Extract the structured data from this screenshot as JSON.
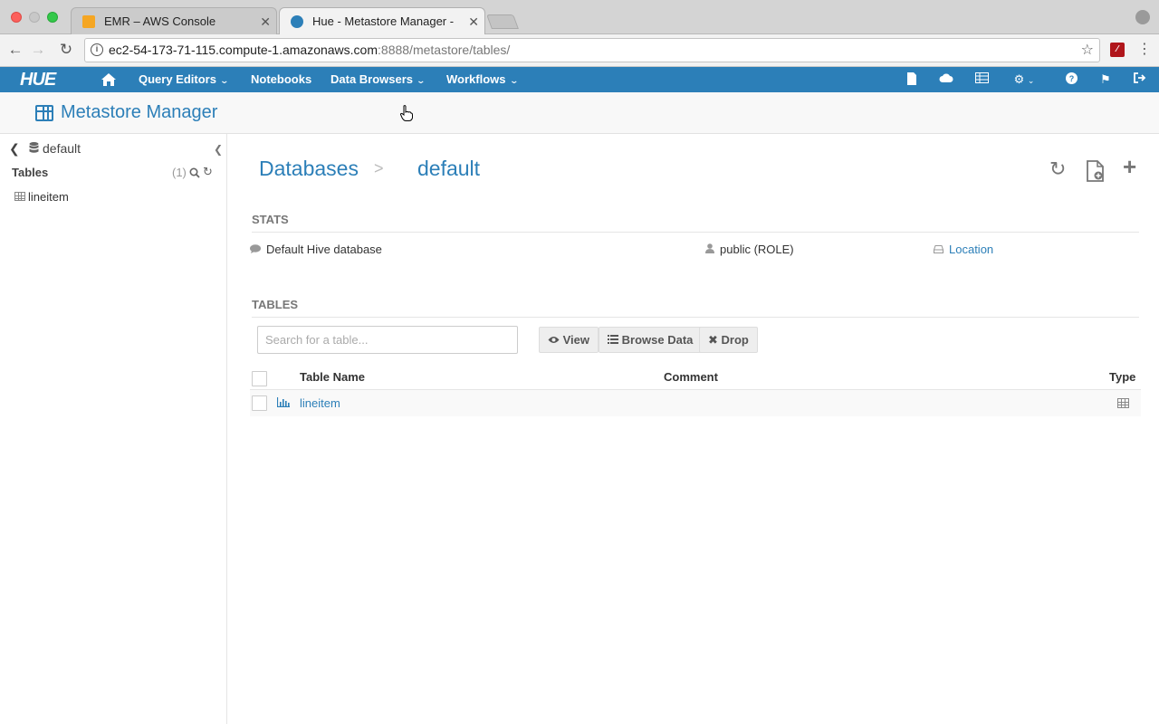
{
  "browser": {
    "tabs": [
      {
        "title": "EMR – AWS Console",
        "active": false
      },
      {
        "title": "Hue - Metastore Manager - Me",
        "active": true
      }
    ],
    "url": {
      "host": "ec2-54-173-71-115.compute-1.amazonaws.com",
      "rest": ":8888/metastore/tables/"
    },
    "close_glyph": "✕"
  },
  "hue_nav": {
    "logo": "HUE",
    "items": [
      {
        "label": "Query Editors",
        "has_dropdown": true
      },
      {
        "label": "Notebooks",
        "has_dropdown": false
      },
      {
        "label": "Data Browsers",
        "has_dropdown": true
      },
      {
        "label": "Workflows",
        "has_dropdown": true
      }
    ],
    "right_icons": [
      "file-icon",
      "cloud-icon",
      "table-icon",
      "cogs-icon",
      "help-icon",
      "flag-icon",
      "logout-icon"
    ]
  },
  "page_header": {
    "title": "Metastore Manager"
  },
  "sidebar": {
    "database": "default",
    "tables_label": "Tables",
    "tables_count": "(1)",
    "tables": [
      {
        "name": "lineitem"
      }
    ]
  },
  "main": {
    "breadcrumb": {
      "root": "Databases",
      "separator": ">",
      "current": "default"
    },
    "stats": {
      "heading": "STATS",
      "comment": "Default Hive database",
      "owner": "public (ROLE)",
      "location": "Location"
    },
    "tables": {
      "heading": "TABLES",
      "search_placeholder": "Search for a table...",
      "buttons": {
        "view": "View",
        "browse": "Browse Data",
        "drop": "Drop"
      },
      "columns": [
        "Table Name",
        "Comment",
        "Type"
      ],
      "rows": [
        {
          "name": "lineitem",
          "comment": "",
          "type": "table-icon"
        }
      ]
    }
  },
  "colors": {
    "hue_blue": "#2c7fb8",
    "nav_text": "#ffffff",
    "muted": "#777777"
  }
}
